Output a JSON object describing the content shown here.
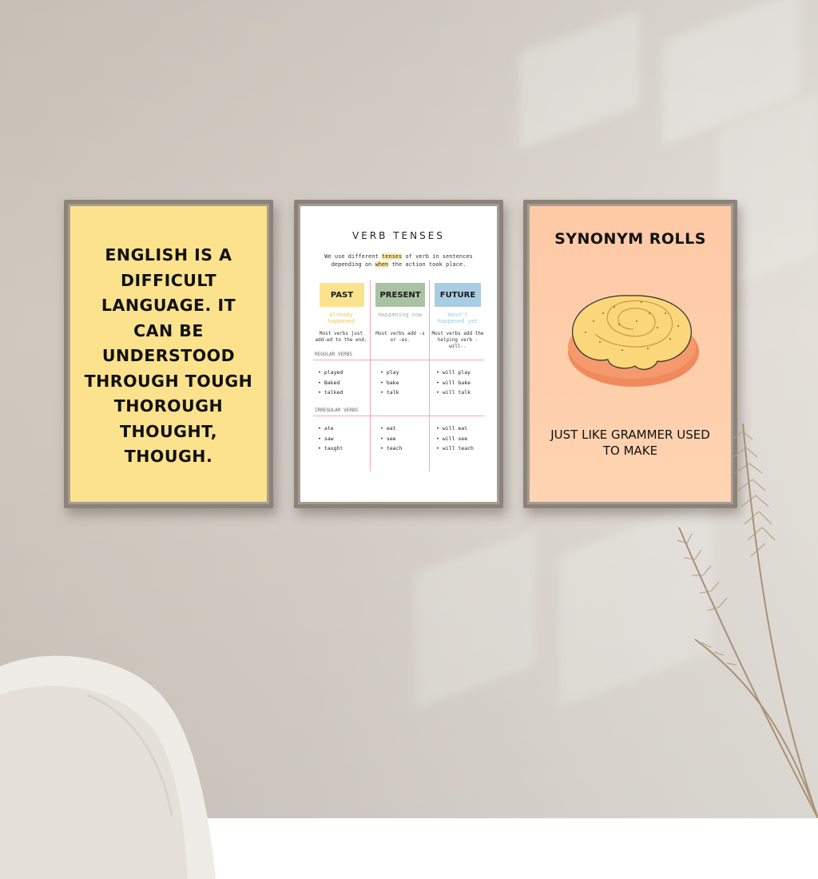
{
  "scene": {
    "wall_color": "#d6d0c8",
    "frame_color": "#8c8378"
  },
  "poster_left": {
    "background": "#fde28d",
    "lines": [
      "ENGLISH IS A",
      "DIFFICULT",
      "LANGUAGE. IT",
      "CAN BE",
      "UNDERSTOOD",
      "THROUGH TOUGH",
      "THOROUGH",
      "THOUGHT,",
      "THOUGH."
    ]
  },
  "poster_middle": {
    "title": "VERB TENSES",
    "subtitle_parts": [
      "We use different ",
      "tenses",
      " of verb in sentences",
      "depending on ",
      "when",
      " the action took place."
    ],
    "columns": [
      {
        "label": "PAST",
        "color": "#fbe38e",
        "hint_color": "#e9c65a",
        "hint": "Already happened",
        "desc": "Most verbs just add-ed to the end.",
        "regular": [
          "• played",
          "• Baked",
          "• talked"
        ],
        "irregular": [
          "• ate",
          "• saw",
          "• taught"
        ]
      },
      {
        "label": "PRESENT",
        "color": "#a9c2a2",
        "hint_color": "#9fb39a",
        "hint": "Happening now",
        "desc": "Most verbs add -s or -es.",
        "regular": [
          "• play",
          "• bake",
          "• talk"
        ],
        "irregular": [
          "• eat",
          "• see",
          "• teach"
        ]
      },
      {
        "label": "FUTURE",
        "color": "#a8cde3",
        "hint_color": "#9cc7e0",
        "hint": "Hasn't happened yet",
        "desc": "Most verbs add the helping verb -will-.",
        "regular": [
          "• will play",
          "• will bake",
          "• will talk"
        ],
        "irregular": [
          "• will eat",
          "• will see",
          "• will teach"
        ]
      }
    ],
    "section_regular": "REGULAR VERBS",
    "section_irregular": "IRREGULAR VERBS",
    "line_color": "#f3a9b4"
  },
  "poster_right": {
    "title": "SYNONYM ROLLS",
    "caption_line1": "JUST LIKE GRAMMER USED",
    "caption_line2": "TO MAKE",
    "bun_icon": "cinnamon-roll-illustration"
  }
}
